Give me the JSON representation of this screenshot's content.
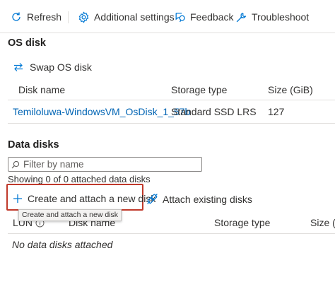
{
  "toolbar": {
    "refresh": "Refresh",
    "additional_settings": "Additional settings",
    "feedback": "Feedback",
    "troubleshoot": "Troubleshoot"
  },
  "os_disk": {
    "heading": "OS disk",
    "swap_label": "Swap OS disk",
    "columns": [
      "Disk name",
      "Storage type",
      "Size (GiB)"
    ],
    "row": {
      "disk_name": "Temiloluwa-WindowsVM_OsDisk_1_57b",
      "storage_type": "Standard SSD LRS",
      "size": "127"
    }
  },
  "data_disks": {
    "heading": "Data disks",
    "filter_placeholder": "Filter by name",
    "count_text": "Showing 0 of 0 attached data disks",
    "create_attach_label": "Create and attach a new disk",
    "attach_existing_label": "Attach existing disks",
    "tooltip": "Create and attach a new disk",
    "columns": [
      "LUN",
      "Disk name",
      "Storage type",
      "Size (G"
    ],
    "empty_text": "No data disks attached"
  },
  "colors": {
    "accent": "#0078d4",
    "link": "#0064b4",
    "highlight_border": "#c0392b"
  }
}
